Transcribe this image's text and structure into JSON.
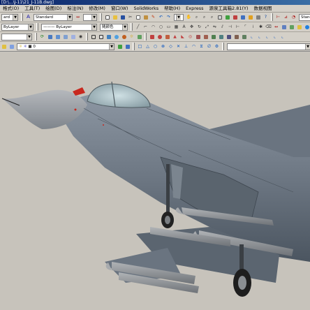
{
  "window": {
    "title": "[D:\\...\\J-11\\21_J-11B.dwg]"
  },
  "menu": {
    "items": [
      "格式(O)",
      "工具(T)",
      "绘图(D)",
      "标注(N)",
      "修改(M)",
      "窗口(W)",
      "SolidWorks",
      "帮助(H)",
      "Express",
      "源泉工具箱2.81(Y)",
      "数据视图"
    ]
  },
  "toolbar1": {
    "style_combo": "Standard",
    "dim_combo": "Standard"
  },
  "toolbar2": {
    "layer_combo": "ByLayer",
    "linetype_combo": "ByLayer",
    "color_combo": "随颜色"
  },
  "toolbar3": {
    "view_combo": ""
  },
  "icons": {
    "row1": [
      "new-icon",
      "open-icon",
      "save-icon",
      "print-icon",
      "preview-icon",
      "cut-icon",
      "copy-icon",
      "paste-icon",
      "match-icon",
      "undo-icon",
      "redo-icon",
      "pan-icon",
      "zoom-icon",
      "zoom-window-icon",
      "zoom-prev-icon",
      "properties-icon",
      "design-center-icon",
      "tool-palette-icon",
      "sheet-icon",
      "markup-icon",
      "calc-icon",
      "help-icon"
    ],
    "colors": {
      "accent": "#0a246a",
      "toolbar": "#d4d0c8",
      "viewport": "#c7c3bb"
    }
  }
}
